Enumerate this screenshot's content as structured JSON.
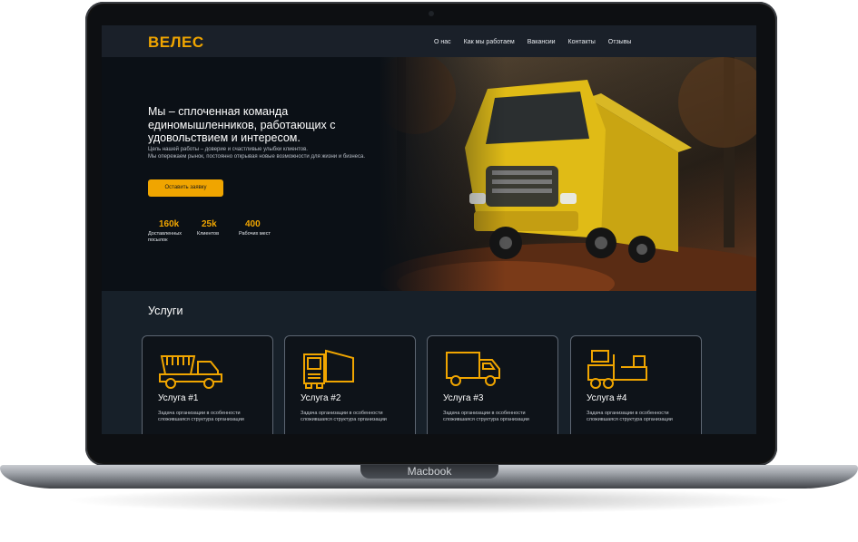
{
  "device": {
    "label": "Macbook"
  },
  "header": {
    "logo": "ВЕЛЕС",
    "nav": [
      "О нас",
      "Как мы работаем",
      "Вакансии",
      "Контакты",
      "Отзывы"
    ]
  },
  "hero": {
    "title": "Мы – сплоченная команда единомышленников, работающих с удовольствием и интересом.",
    "description_line1": "Цель нашей работы – доверие и счастливые улыбки клиентов.",
    "description_line2": "Мы опережаем рынок, постоянно открывая новые возможности для жизни и бизнеса.",
    "button": "Оставить заявку",
    "stats": [
      {
        "value": "160k",
        "label": "Доставленных посылок"
      },
      {
        "value": "25k",
        "label": "Клиентов"
      },
      {
        "value": "400",
        "label": "Рабочих мест"
      }
    ],
    "image": "yellow-truck-photo"
  },
  "services": {
    "title": "Услуги",
    "cards": [
      {
        "title": "Услуга #1",
        "text": "Задача организации в особенности сложившаяся структура организации",
        "icon": "dump-truck-icon"
      },
      {
        "title": "Услуга #2",
        "text": "Задача организации в особенности сложившаяся структура организации",
        "icon": "semi-truck-icon"
      },
      {
        "title": "Услуга #3",
        "text": "Задача организации в особенности сложившаяся структура организации",
        "icon": "delivery-truck-icon"
      },
      {
        "title": "Услуга #4",
        "text": "Задача организации в особенности сложившаяся структура организации",
        "icon": "forklift-icon"
      }
    ]
  },
  "colors": {
    "accent": "#f0a500",
    "background": "#0e1319",
    "header": "#1a2029",
    "services_bg": "#172029"
  }
}
